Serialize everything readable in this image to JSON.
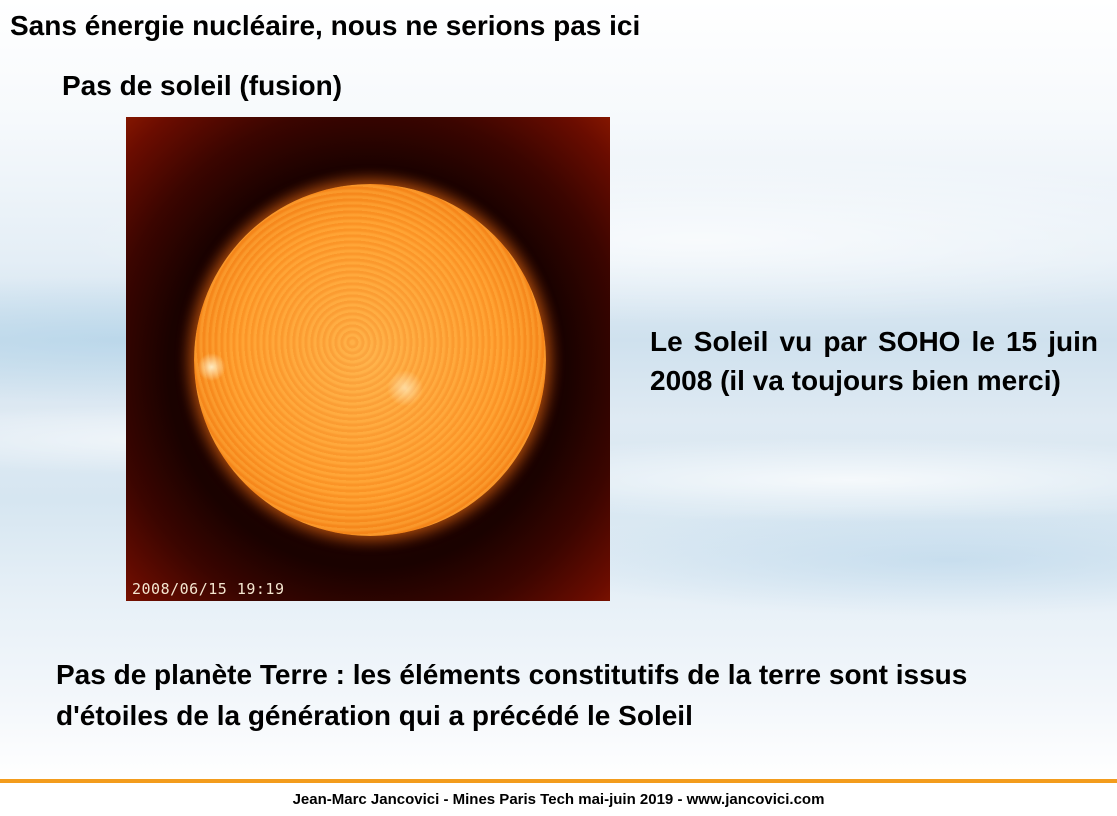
{
  "slide": {
    "title": "Sans énergie nucléaire, nous ne serions pas ici",
    "subtitle": "Pas de soleil (fusion)",
    "image": {
      "timestamp": "2008/06/15 19:19"
    },
    "caption": "Le Soleil vu par SOHO le 15 juin 2008 (il va toujours bien merci)",
    "bottom_text": "Pas de planète Terre : les éléments constitutifs de la terre sont issus d'étoiles de la génération qui a précédé le Soleil"
  },
  "footer": {
    "text": "Jean-Marc Jancovici - Mines Paris Tech mai-juin 2019 - www.jancovici.com",
    "rule_color": "#f39c1d"
  }
}
